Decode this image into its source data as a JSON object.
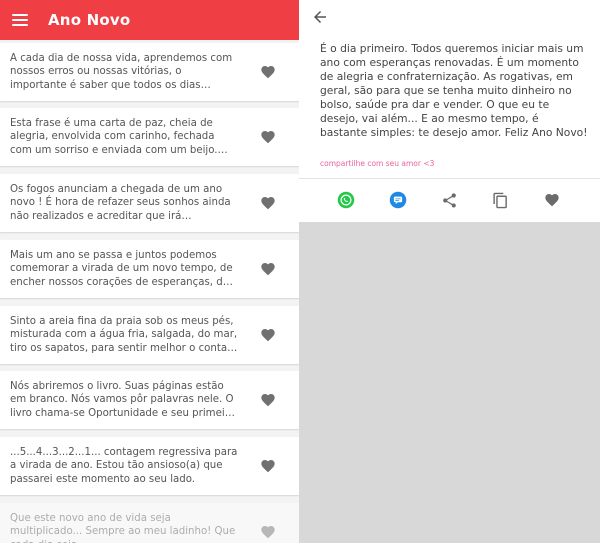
{
  "app": {
    "title": "Ano Novo"
  },
  "list": {
    "items": [
      {
        "text": "A cada dia de nossa vida, aprendemos com nossos erros ou nossas vitórias, o importante é saber que todos os dias vivemos algo novo. ..."
      },
      {
        "text": "Esta frase é uma carta de paz, cheia de alegria, envolvida com carinho, fechada com um sorriso e enviada com um beijo. Feliz Ano Novo."
      },
      {
        "text": "Os fogos anunciam a chegada de um ano novo ! É hora de refazer seus sonhos ainda não realizados e acreditar que irá concretizá-los. S..."
      },
      {
        "text": "Mais um ano se passa e juntos podemos comemorar a virada de um novo tempo, de encher nossos corações de esperanças, de diz..."
      },
      {
        "text": "Sinto a areia fina da praia sob os meus pés, misturada com a água fria, salgada, do mar, tiro os sapatos, para sentir melhor o contato d..."
      },
      {
        "text": "Nós abriremos o livro. Suas páginas estão em branco. Nós vamos pôr palavras nele. O livro chama-se Oportunidade e seu primeiro capítul..."
      },
      {
        "text": "...5...4...3...2...1... contagem regressiva para a virada de ano. Estou tão ansioso(a) que passarei este momento ao seu lado."
      },
      {
        "text": "Que este novo ano de vida seja multiplicado... Sempre ao meu ladinho! Que cada dia seja..."
      }
    ]
  },
  "detail": {
    "text": "É o dia primeiro. Todos queremos iniciar mais um ano com esperanças renovadas. É um momento de alegria e confraternização. As rogativas, em geral, são para que se tenha muito dinheiro no bolso, saúde pra dar e vender. O que eu te desejo, vai além... E ao mesmo tempo, é bastante simples: te desejo amor. Feliz Ano Novo!",
    "share_text": "compartilhe com seu amor <3"
  },
  "icons": {
    "menu": "menu-icon",
    "heart": "heart-icon",
    "back": "back-arrow-icon",
    "whatsapp": "whatsapp-icon",
    "message": "message-icon",
    "share": "share-icon",
    "copy": "copy-icon",
    "favorite": "heart-icon"
  },
  "colors": {
    "appbar": "#ef3e44",
    "heart": "#707070",
    "whatsapp": "#25c84a",
    "message": "#1e88e5",
    "share_text": "#e8649a"
  }
}
